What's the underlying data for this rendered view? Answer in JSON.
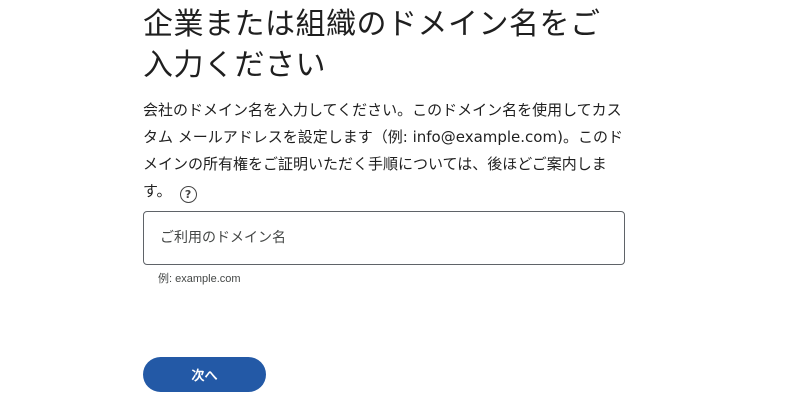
{
  "heading": {
    "title": "企業または組織のドメイン名をご入力ください"
  },
  "description": {
    "text": "会社のドメイン名を入力してください。このドメイン名を使用してカスタム メールアドレスを設定します（例: info@example.com)。このドメインの所有権をご証明いただく手順については、後ほどご案内します。",
    "help_icon": "help-circle-icon",
    "help_glyph": "?"
  },
  "domain_field": {
    "placeholder": "ご利用のドメイン名",
    "value": "",
    "hint": "例: example.com"
  },
  "actions": {
    "next_label": "次へ",
    "accent_color": "#2359a6"
  }
}
